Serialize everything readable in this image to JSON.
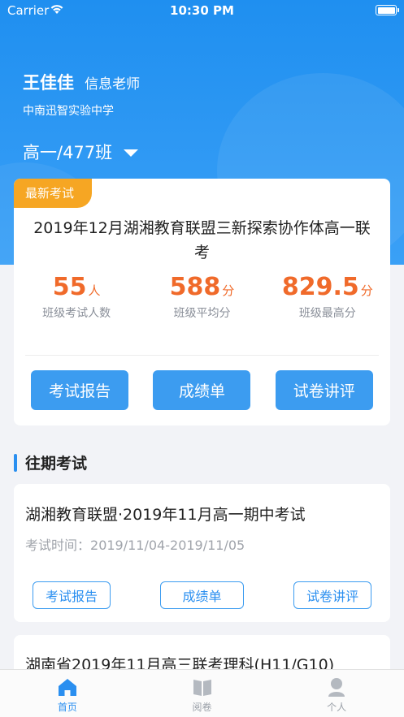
{
  "status_bar": {
    "carrier": "Carrier",
    "time": "10:30 PM"
  },
  "header": {
    "teacher_name": "王佳佳",
    "role": "信息老师",
    "school": "中南迅智实验中学",
    "class_selector": "高一/477班"
  },
  "latest_exam": {
    "tag": "最新考试",
    "title": "2019年12月湖湘教育联盟三新探索协作体高一联考",
    "stats": [
      {
        "value": "55",
        "unit": "人",
        "label": "班级考试人数"
      },
      {
        "value": "588",
        "unit": "分",
        "label": "班级平均分"
      },
      {
        "value": "829.5",
        "unit": "分",
        "label": "班级最高分"
      }
    ],
    "buttons": [
      "考试报告",
      "成绩单",
      "试卷讲评"
    ]
  },
  "past_section": {
    "title": "往期考试"
  },
  "past_exams": [
    {
      "title": "湖湘教育联盟·2019年11月高一期中考试",
      "time_label": "考试时间：",
      "time_range": "2019/11/04-2019/11/05",
      "buttons": [
        "考试报告",
        "成绩单",
        "试卷讲评"
      ]
    },
    {
      "title": "湖南省2019年11月高三联考理科(H11/G10)"
    }
  ],
  "tabbar": {
    "items": [
      {
        "label": "首页",
        "icon": "home-icon",
        "active": true
      },
      {
        "label": "阅卷",
        "icon": "book-icon",
        "active": false
      },
      {
        "label": "个人",
        "icon": "person-icon",
        "active": false
      }
    ]
  },
  "colors": {
    "primary": "#2a8ff0",
    "accent_orange": "#f06a2a",
    "tag_orange": "#f6a623"
  }
}
